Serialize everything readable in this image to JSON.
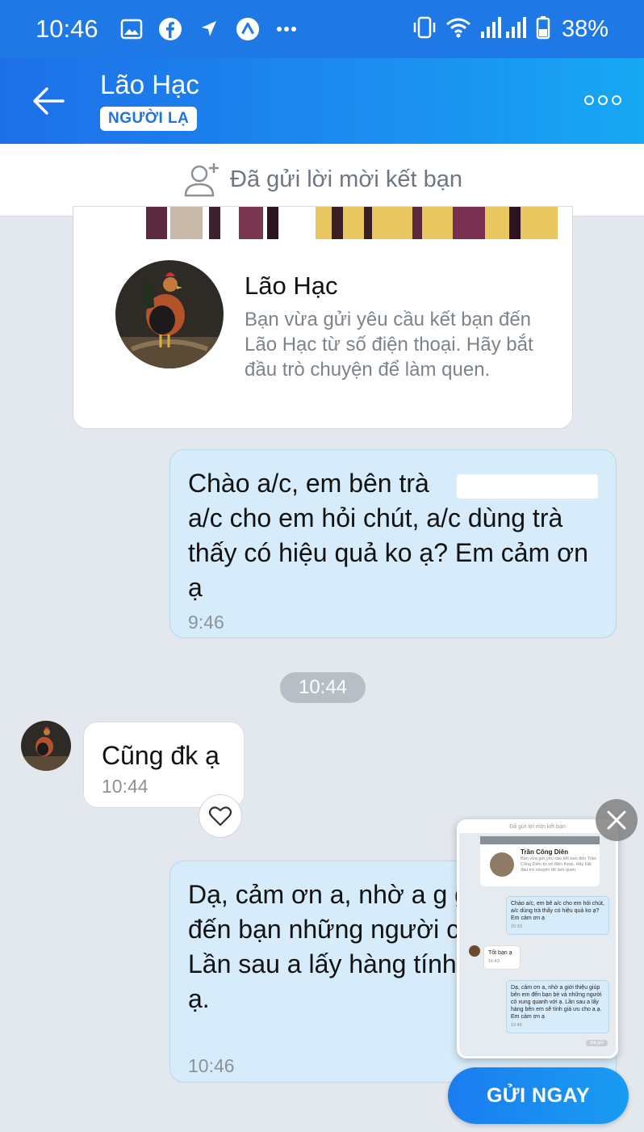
{
  "status_bar": {
    "time": "10:46",
    "battery": "38%",
    "icons": [
      "gallery-icon",
      "facebook-icon",
      "location-arrow-icon",
      "app-icon",
      "more-notifications-icon",
      "vibrate-icon",
      "wifi-icon",
      "signal-icon",
      "battery-icon"
    ]
  },
  "header": {
    "title": "Lão Hạc",
    "badge": "NGƯỜI LẠ"
  },
  "friend_request": {
    "text": "Đã gửi lời mời kết bạn"
  },
  "profile_card": {
    "name": "Lão Hạc",
    "description": "Bạn vừa gửi yêu cầu kết bạn đến Lão Hạc từ số điện thoại. Hãy bắt đầu trò chuyện để làm quen."
  },
  "messages": [
    {
      "direction": "out",
      "text_line1": "Chào a/c, em bên trà",
      "text_rest": "a/c cho em hỏi chút, a/c dùng trà thấy có hiệu quả ko ạ? Em cảm ơn ạ",
      "time": "9:46"
    },
    {
      "direction": "in",
      "text": "Cũng đk ạ",
      "time": "10:44"
    },
    {
      "direction": "out",
      "text": "Dạ, cảm ơn a, nhờ a g giúp bên em đến bạn những người có xung ạ. Lần sau a lấy hàng tính giá ưu cho a ạ.",
      "time": "10:46"
    }
  ],
  "time_divider": "10:44",
  "preview": {
    "top_text": "Đã gửi lời mời kết bạn",
    "card_name": "Trần Công Diên",
    "card_desc": "Bạn vừa gửi yêu cầu kết bạn đến Trần Công Diên từ số điện thoại. Hãy bắt đầu trò chuyện để làm quen.",
    "msg1": "Chào a/c, em bê a/c cho em hỏi chút, a/c dùng trà thấy có hiệu quả ko ạ? Em cảm ơn ạ",
    "msg1_time": "15:33",
    "msg2": "Tốt bạn ạ",
    "msg2_time": "16:43",
    "msg3": "Dạ, cảm ơn a, nhờ a giới thiệu giúp bên em đến bạn bè và những người có xung quanh với ạ. Lần sau a lấy hàng bên em sẽ tính giá ưu cho a ạ. Em cảm ơn ạ",
    "msg3_time": "16:46",
    "seen": "Đã gửi"
  },
  "send_button": "GỬI NGAY",
  "colors": {
    "accent": "#1d6fe8",
    "outgoing_bubble": "#d7ecfb",
    "chat_bg": "#e3e8ee"
  }
}
